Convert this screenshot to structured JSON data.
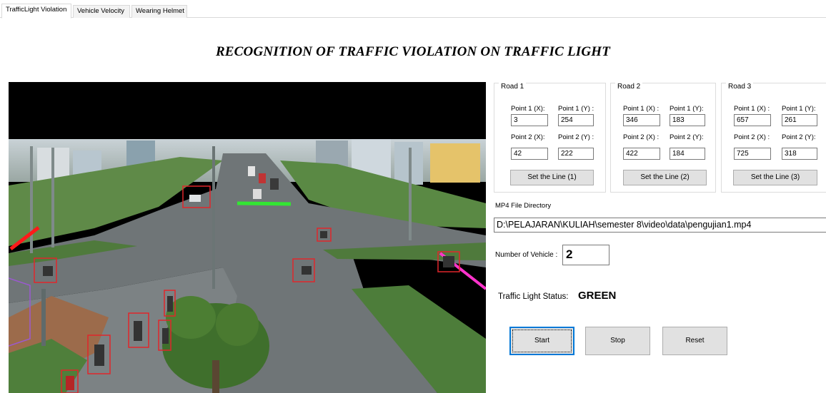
{
  "tabs": [
    {
      "label": "TrafficLight Violation",
      "active": true
    },
    {
      "label": "Vehicle Velocity",
      "active": false
    },
    {
      "label": "Wearing Helmet",
      "active": false
    }
  ],
  "page_title": "RECOGNITION OF TRAFFIC VIOLATION ON TRAFFIC LIGHT",
  "roads": [
    {
      "title": "Road 1",
      "p1x_label": "Point 1 (X):",
      "p1y_label": "Point 1 (Y) :",
      "p2x_label": "Point 2 (X):",
      "p2y_label": "Point 2 (Y) :",
      "p1x": "3",
      "p1y": "254",
      "p2x": "42",
      "p2y": "222",
      "button": "Set the Line (1)"
    },
    {
      "title": "Road 2",
      "p1x_label": "Point 1 (X) :",
      "p1y_label": "Point 1 (Y):",
      "p2x_label": "Point 2 (X) :",
      "p2y_label": "Point 2 (Y):",
      "p1x": "346",
      "p1y": "183",
      "p2x": "422",
      "p2y": "184",
      "button": "Set the Line (2)"
    },
    {
      "title": "Road 3",
      "p1x_label": "Point 1 (X) :",
      "p1y_label": "Point 1 (Y):",
      "p2x_label": "Point 2 (X) :",
      "p2y_label": "Point 2 (Y):",
      "p1x": "657",
      "p1y": "261",
      "p2x": "725",
      "p2y": "318",
      "button": "Set the Line (3)"
    }
  ],
  "mp4": {
    "label": "MP4 File Directory",
    "path": "D:\\PELAJARAN\\KULIAH\\semester 8\\video\\data\\pengujian1.mp4"
  },
  "vehicles": {
    "label": "Number of Vehicle :",
    "count": "2"
  },
  "traffic_light": {
    "label": "Traffic Light Status:",
    "status": "GREEN"
  },
  "buttons": {
    "start": "Start",
    "stop": "Stop",
    "reset": "Reset"
  },
  "colors": {
    "detection_box": "#e0262b",
    "line_road1": "#ff1a1a",
    "line_road2": "#33e633",
    "line_road3": "#ff33cc",
    "focus_border": "#0078d7"
  }
}
